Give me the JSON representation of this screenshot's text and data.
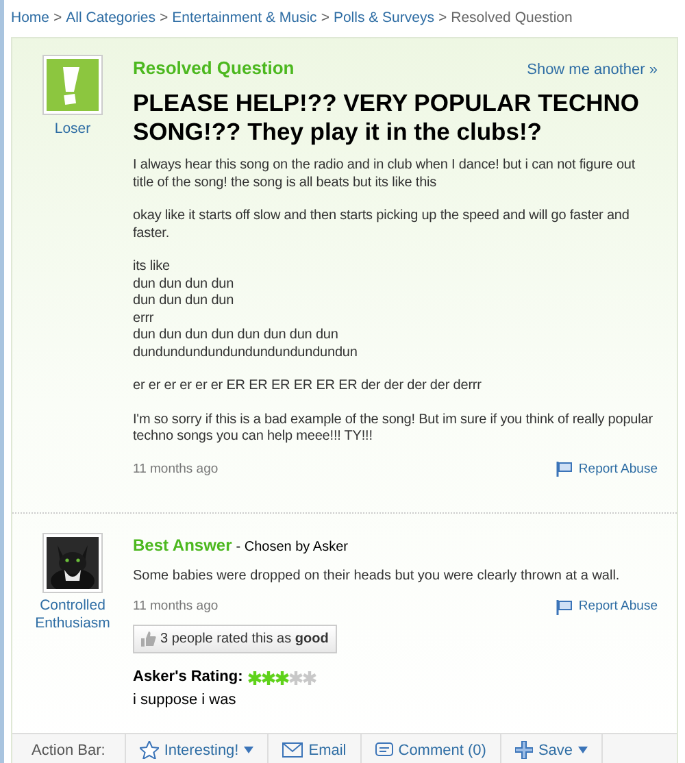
{
  "breadcrumb": [
    {
      "label": "Home",
      "link": true
    },
    {
      "label": "All Categories",
      "link": true
    },
    {
      "label": "Entertainment & Music",
      "link": true
    },
    {
      "label": "Polls & Surveys",
      "link": true
    },
    {
      "label": "Resolved Question",
      "link": false
    }
  ],
  "breadcrumb_separator": ">",
  "question": {
    "status": "Resolved Question",
    "show_another": "Show me another »",
    "asker": "Loser",
    "title": "PLEASE HELP!?? VERY POPULAR TECHNO SONG!?? They play it in the clubs!?",
    "paragraphs": [
      [
        "I always hear this song on the radio and in club when I dance! but i can not figure out title of the song! the song is all beats but its like this"
      ],
      [
        "okay like it starts off slow and then starts picking up the speed and will go faster and faster."
      ],
      [
        "its like",
        "dun dun dun dun",
        "dun dun dun dun",
        "errr",
        "dun dun dun dun dun dun dun dun",
        "dundundundundundundundundundun"
      ],
      [
        "er er er er er er ER ER ER ER ER ER der der der der derrr"
      ],
      [
        "I'm so sorry if this is a bad example of the song! But im sure if you think of really popular techno songs you can help meee!!! TY!!!"
      ]
    ],
    "time": "11 months ago",
    "report": "Report Abuse"
  },
  "best_answer": {
    "label": "Best Answer",
    "chosen": "- Chosen by Asker",
    "answerer": "Controlled Enthusiasm",
    "text": "Some babies were dropped on their heads but you were clearly thrown at a wall.",
    "time": "11 months ago",
    "report": "Report Abuse",
    "rated": "3 people rated this as **good**",
    "rating_label": "Asker's Rating:",
    "stars": 3,
    "comment": "i suppose i was"
  },
  "action_bar": {
    "label": "Action Bar:",
    "items": [
      {
        "kind": "interesting",
        "label": "Interesting!",
        "dropdown": true
      },
      {
        "kind": "email",
        "label": "Email",
        "dropdown": false
      },
      {
        "kind": "comment",
        "label": "Comment (0)",
        "dropdown": false
      },
      {
        "kind": "save",
        "label": "Save",
        "dropdown": true
      }
    ]
  }
}
